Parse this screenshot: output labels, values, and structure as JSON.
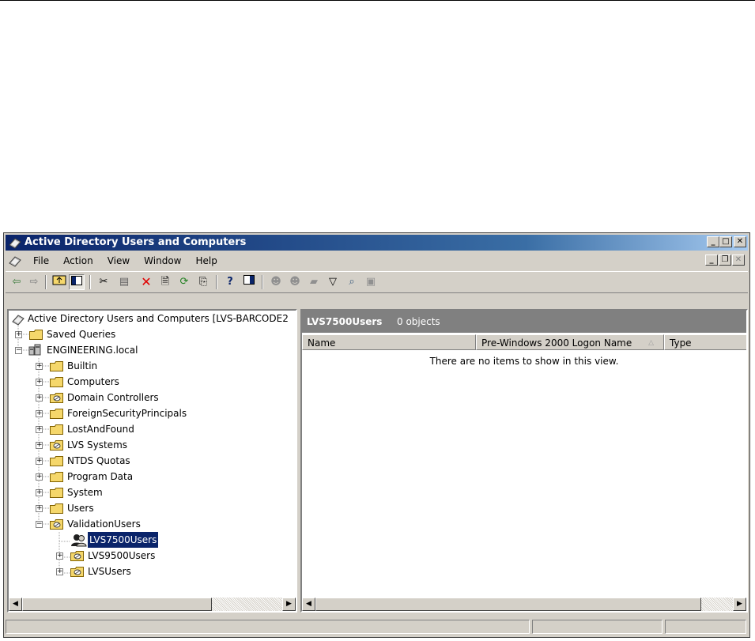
{
  "window": {
    "title": "Active Directory Users and Computers"
  },
  "menu": {
    "items": [
      "File",
      "Action",
      "View",
      "Window",
      "Help"
    ]
  },
  "toolbar": {
    "icons": [
      "back-icon",
      "forward-icon",
      "up-folder-icon",
      "show-hide-tree-icon",
      "cut-icon",
      "paste-icon",
      "delete-icon",
      "properties-icon",
      "refresh-icon",
      "export-list-icon",
      "help-icon",
      "console-tree-icon",
      "new-user-icon",
      "new-group-icon",
      "new-ou-icon",
      "filter-icon",
      "find-icon",
      "add-to-group-icon"
    ]
  },
  "tree": {
    "root": "Active Directory Users and Computers [LVS-BARCODE2",
    "items": [
      {
        "label": "Saved Queries",
        "expander": "+"
      },
      {
        "label": "ENGINEERING.local",
        "expander": "−"
      },
      {
        "label": "Builtin",
        "expander": "+"
      },
      {
        "label": "Computers",
        "expander": "+"
      },
      {
        "label": "Domain Controllers",
        "expander": "+"
      },
      {
        "label": "ForeignSecurityPrincipals",
        "expander": "+"
      },
      {
        "label": "LostAndFound",
        "expander": "+"
      },
      {
        "label": "LVS Systems",
        "expander": "+"
      },
      {
        "label": "NTDS Quotas",
        "expander": "+"
      },
      {
        "label": "Program Data",
        "expander": "+"
      },
      {
        "label": "System",
        "expander": "+"
      },
      {
        "label": "Users",
        "expander": "+"
      },
      {
        "label": "ValidationUsers",
        "expander": "−"
      },
      {
        "label": "LVS7500Users",
        "expander": ""
      },
      {
        "label": "LVS9500Users",
        "expander": "+"
      },
      {
        "label": "LVSUsers",
        "expander": "+"
      }
    ]
  },
  "details": {
    "container_name": "LVS7500Users",
    "object_count": "0 objects",
    "columns": [
      "Name",
      "Pre-Windows 2000 Logon Name",
      "Type"
    ],
    "empty_message": "There are no items to show in this view."
  },
  "colors": {
    "titlebar_start": "#0a246a",
    "titlebar_end": "#a6caf0",
    "selection": "#0a246a",
    "folder": "#f5d76b",
    "chrome": "#d4d0c8"
  }
}
